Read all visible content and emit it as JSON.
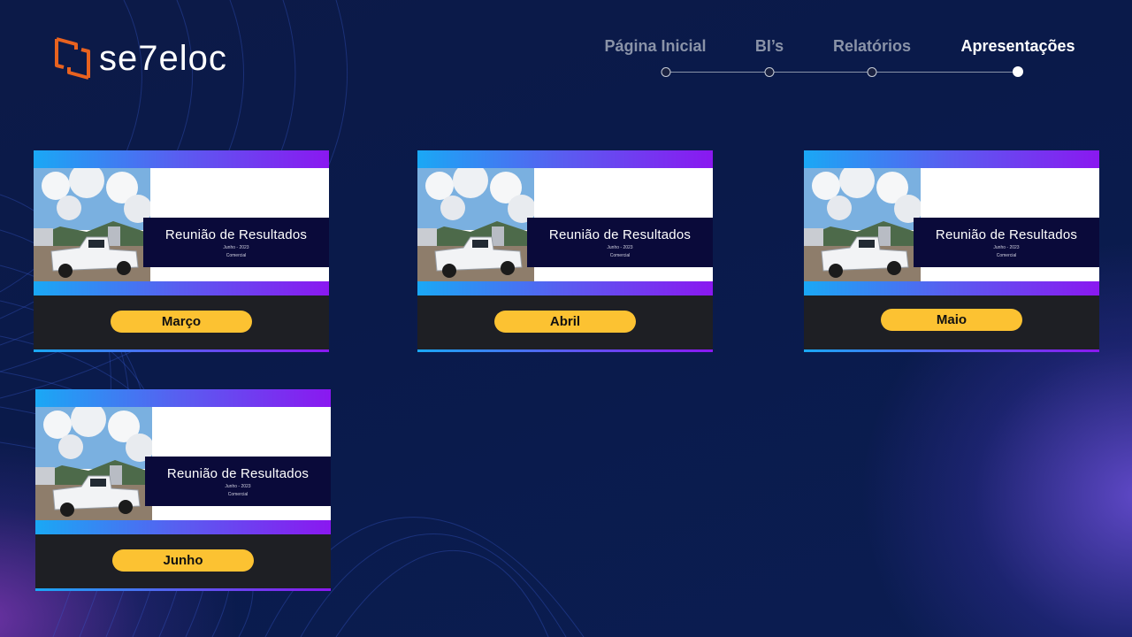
{
  "logo": {
    "text": "se7eloc",
    "accent_color": "#e8621f"
  },
  "nav": {
    "items": [
      {
        "label": "Página Inicial",
        "active": false
      },
      {
        "label": "BI’s",
        "active": false
      },
      {
        "label": "Relatórios",
        "active": false
      },
      {
        "label": "Apresentações",
        "active": true
      }
    ]
  },
  "cards": [
    {
      "slide_title": "Reunião de Resultados",
      "slide_sub1": "Junho - 2023",
      "slide_sub2": "Comercial",
      "button": "Março"
    },
    {
      "slide_title": "Reunião de Resultados",
      "slide_sub1": "Junho - 2023",
      "slide_sub2": "Comercial",
      "button": "Abril"
    },
    {
      "slide_title": "Reunião de Resultados",
      "slide_sub1": "Junho - 2023",
      "slide_sub2": "Comercial",
      "button": "Maio"
    },
    {
      "slide_title": "Reunião de Resultados",
      "slide_sub1": "Junho - 2023",
      "slide_sub2": "Comercial",
      "button": "Junho"
    }
  ],
  "colors": {
    "background": "#0b1b4d",
    "button": "#fcc232",
    "gradient_start": "#1aa8f5",
    "gradient_end": "#8a18f0",
    "panel": "#1e1f24"
  }
}
